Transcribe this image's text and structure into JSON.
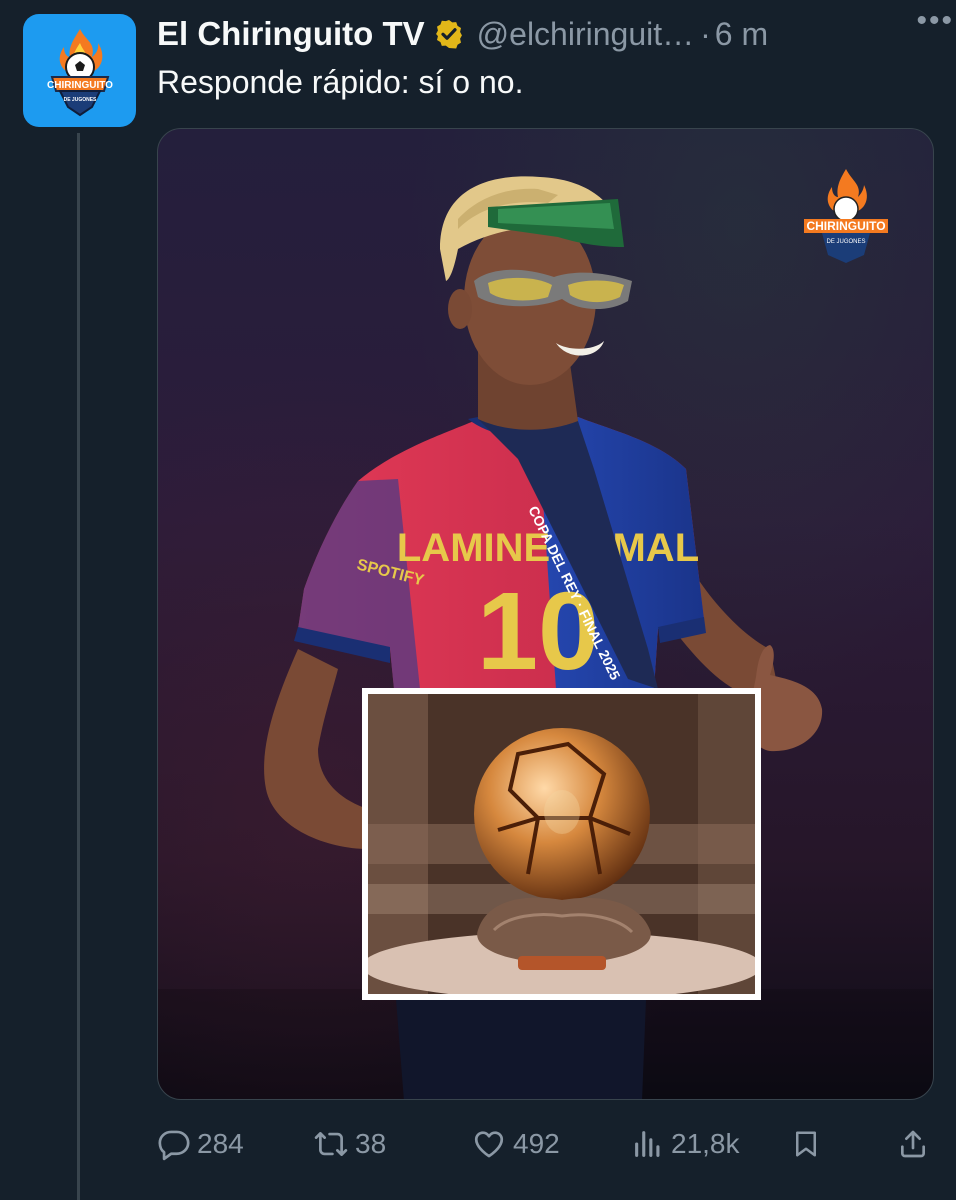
{
  "tweet": {
    "display_name": "El Chiringuito TV",
    "handle": "@elchiringuit…",
    "separator": "·",
    "time": "6 m",
    "text": "Responde rápido: sí o no.",
    "more_glyph": "•••"
  },
  "avatar": {
    "brand_text": "CHIRINGUITO",
    "sub_text": "DE JUGONES"
  },
  "media": {
    "watermark_brand": "CHIRINGUITO",
    "watermark_sub": "DE JUGONES",
    "jersey_name": "LAMINE YAMAL",
    "jersey_number": "10",
    "sponsor_text": "SPOTIFY",
    "lanyard_text": "COPA DEL REY · FINAL 2025"
  },
  "actions": {
    "replies": "284",
    "reposts": "38",
    "likes": "492",
    "views": "21,8k"
  },
  "colors": {
    "background": "#15202b",
    "text_primary": "#f7f9f9",
    "text_secondary": "#8b98a5",
    "verified_badge": "#e2b719",
    "avatar_bg": "#1d9bf0"
  }
}
